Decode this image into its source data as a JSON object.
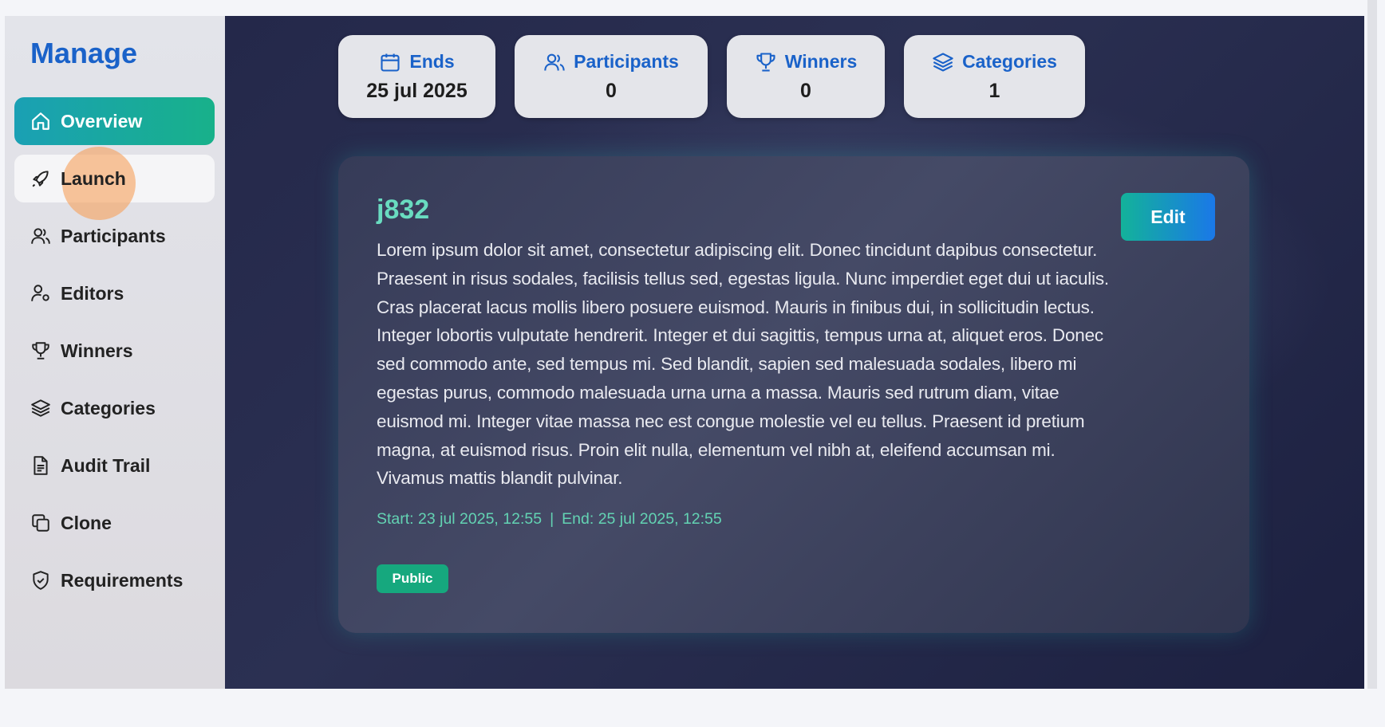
{
  "sidebar": {
    "brand": "Manage",
    "items": [
      {
        "label": "Overview",
        "icon": "home-icon"
      },
      {
        "label": "Launch",
        "icon": "rocket-icon"
      },
      {
        "label": "Participants",
        "icon": "users-icon"
      },
      {
        "label": "Editors",
        "icon": "user-gear-icon"
      },
      {
        "label": "Winners",
        "icon": "trophy-icon"
      },
      {
        "label": "Categories",
        "icon": "layers-icon"
      },
      {
        "label": "Audit Trail",
        "icon": "document-icon"
      },
      {
        "label": "Clone",
        "icon": "copy-icon"
      },
      {
        "label": "Requirements",
        "icon": "shield-check-icon"
      }
    ]
  },
  "stats": [
    {
      "label": "Ends",
      "value": "25 jul 2025",
      "icon": "calendar-icon"
    },
    {
      "label": "Participants",
      "value": "0",
      "icon": "users-icon"
    },
    {
      "label": "Winners",
      "value": "0",
      "icon": "trophy-icon"
    },
    {
      "label": "Categories",
      "value": "1",
      "icon": "layers-icon"
    }
  ],
  "card": {
    "title": "j832",
    "edit_label": "Edit",
    "description": "Lorem ipsum dolor sit amet, consectetur adipiscing elit. Donec tincidunt dapibus consectetur. Praesent in risus sodales, facilisis tellus sed, egestas ligula. Nunc imperdiet eget dui ut iaculis. Cras placerat lacus mollis libero posuere euismod. Mauris in finibus dui, in sollicitudin lectus. Integer lobortis vulputate hendrerit. Integer et dui sagittis, tempus urna at, aliquet eros. Donec sed commodo ante, sed tempus mi. Sed blandit, sapien sed malesuada sodales, libero mi egestas purus, commodo malesuada urna urna a massa. Mauris sed rutrum diam, vitae euismod mi. Integer vitae massa nec est congue molestie vel eu tellus. Praesent id pretium magna, at euismod risus. Proin elit nulla, elementum vel nibh at, eleifend accumsan mi. Vivamus mattis blandit pulvinar.",
    "start": "Start: 23 jul 2025, 12:55",
    "separator": "|",
    "end": "End: 25 jul 2025, 12:55",
    "badge": "Public"
  },
  "colors": {
    "brand": "#1a62c9",
    "active_gradient_start": "#1aa0b4",
    "active_gradient_end": "#18b18a",
    "title_accent": "#69dcc0",
    "badge": "#16a87e"
  }
}
